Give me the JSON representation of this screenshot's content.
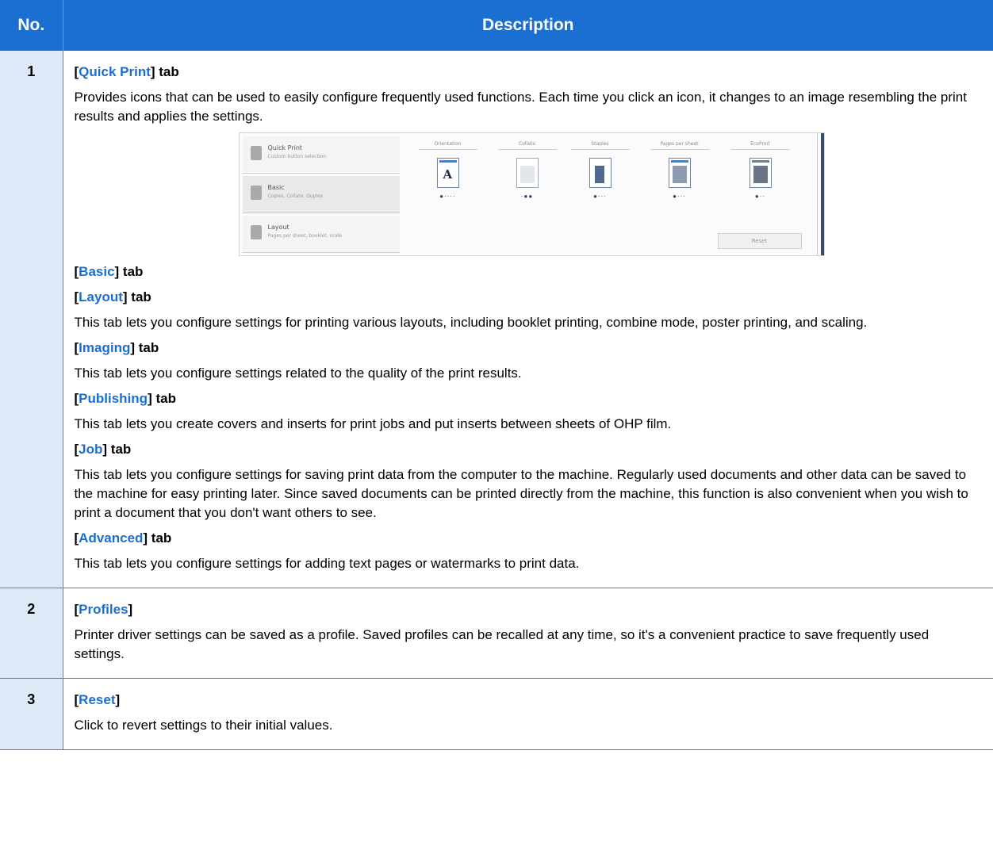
{
  "header": {
    "no": "No.",
    "description": "Description"
  },
  "rows": [
    {
      "no": "1",
      "sections": [
        {
          "pre": "[",
          "link": "Quick Print",
          "post": "] tab",
          "text": "Provides icons that can be used to easily configure frequently used functions. Each time you click an icon, it changes to an image resembling the print results and applies the settings."
        },
        {
          "pre": "[",
          "link": "Basic",
          "post": "] tab",
          "text": ""
        },
        {
          "pre": "[",
          "link": "Layout",
          "post": "] tab",
          "text": "This tab lets you configure settings for printing various layouts, including booklet printing, combine mode, poster printing, and scaling."
        },
        {
          "pre": "[",
          "link": "Imaging",
          "post": "] tab",
          "text": "This tab lets you configure settings related to the quality of the print results."
        },
        {
          "pre": "[",
          "link": "Publishing",
          "post": "] tab",
          "text": "This tab lets you create covers and inserts for print jobs and put inserts between sheets of OHP film."
        },
        {
          "pre": "[",
          "link": "Job",
          "post": "] tab",
          "text": "This tab lets you configure settings for saving print data from the computer to the machine. Regularly used documents and other data can be saved to the machine for easy printing later. Since saved documents can be printed directly from the machine, this function is also convenient when you wish to print a document that you don't want others to see."
        },
        {
          "pre": "[",
          "link": "Advanced",
          "post": "] tab",
          "text": "This tab lets you configure settings for adding text pages or watermarks to print data."
        }
      ]
    },
    {
      "no": "2",
      "sections": [
        {
          "pre": "[",
          "link": "Profiles",
          "post": "]",
          "text": "Printer driver settings can be saved as a profile. Saved profiles can be recalled at any time, so it's a convenient practice to save frequently used settings."
        }
      ]
    },
    {
      "no": "3",
      "sections": [
        {
          "pre": "[",
          "link": "Reset",
          "post": "]",
          "text": "Click to revert settings to their initial values."
        }
      ]
    }
  ],
  "screenshot": {
    "tabs": [
      {
        "title": "Quick Print",
        "subtitle": "Custom button selection"
      },
      {
        "title": "Basic",
        "subtitle": "Copies, Collate, Duplex"
      },
      {
        "title": "Layout",
        "subtitle": "Pages per sheet, booklet, scale"
      }
    ],
    "options": [
      "Orientation",
      "Collate",
      "Staples",
      "Pages per sheet",
      "EcoPrint"
    ],
    "button": "Reset"
  },
  "colors": {
    "accent": "#1a6fd0",
    "no_column_bg": "#dde9f7"
  }
}
